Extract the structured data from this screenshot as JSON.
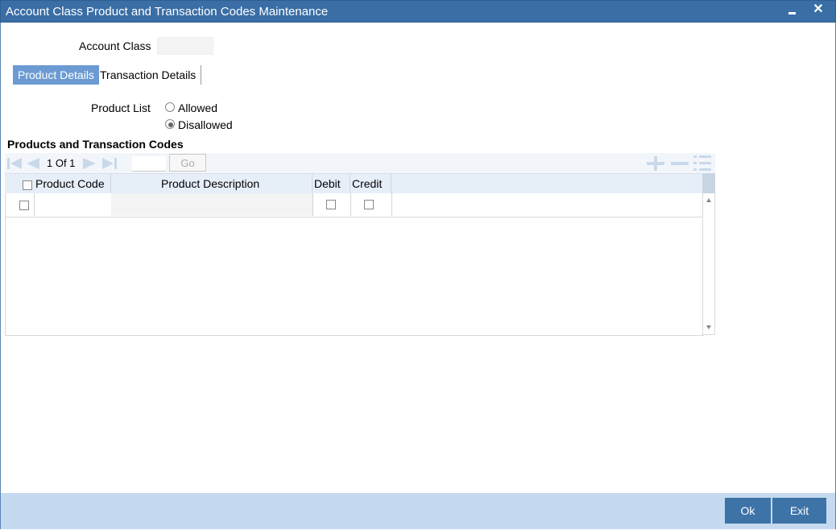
{
  "window": {
    "title": "Account Class Product and Transaction Codes Maintenance",
    "close_glyph": "✕"
  },
  "form": {
    "account_class_label": "Account Class",
    "account_class_value": ""
  },
  "tabs": [
    {
      "label": "Product Details",
      "active": true
    },
    {
      "label": "Transaction Details",
      "active": false
    }
  ],
  "product_list": {
    "label": "Product List",
    "options": [
      {
        "label": "Allowed",
        "selected": false
      },
      {
        "label": "Disallowed",
        "selected": true
      }
    ]
  },
  "grid": {
    "title": "Products and Transaction Codes",
    "pager_text": "1 Of 1",
    "page_input": "",
    "go_label": "Go",
    "columns": [
      "Product Code",
      "Product Description",
      "Debit",
      "Credit"
    ],
    "rows": [
      {
        "product_code": "",
        "product_description": "",
        "debit": false,
        "credit": false
      }
    ]
  },
  "footer": {
    "ok_label": "Ok",
    "exit_label": "Exit"
  },
  "colors": {
    "titlebar": "#3a6ea5",
    "active_tab": "#6b9bd2",
    "footer": "#c5daf0",
    "button": "#3e73a8"
  },
  "icons": [
    "first-page-icon",
    "prev-page-icon",
    "next-page-icon",
    "last-page-icon",
    "add-row-icon",
    "delete-row-icon",
    "single-view-icon",
    "minimize-icon",
    "close-icon"
  ]
}
